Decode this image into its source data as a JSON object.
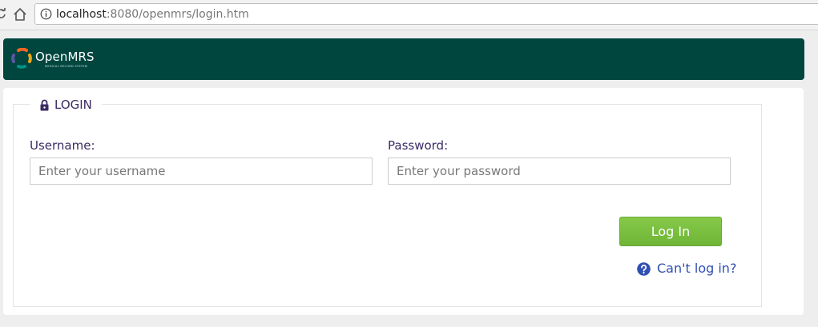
{
  "browser": {
    "url_host": "localhost",
    "url_rest": ":8080/openmrs/login.htm"
  },
  "header": {
    "brand": "OpenMRS",
    "tagline": "MEDICAL RECORD SYSTEM"
  },
  "login": {
    "legend": "LOGIN",
    "username_label": "Username:",
    "username_placeholder": "Enter your username",
    "username_value": "",
    "password_label": "Password:",
    "password_placeholder": "Enter your password",
    "password_value": "",
    "submit_label": "Log In",
    "cant_login_label": "Can't log in?"
  },
  "colors": {
    "header_bg": "#00463f",
    "button_green": "#7dc243",
    "label_purple": "#3b2b63",
    "link_blue": "#2f4fb3"
  },
  "icons": {
    "reload": "reload-icon",
    "home": "home-icon",
    "info": "info-icon",
    "lock": "lock-icon",
    "help": "help-icon"
  }
}
